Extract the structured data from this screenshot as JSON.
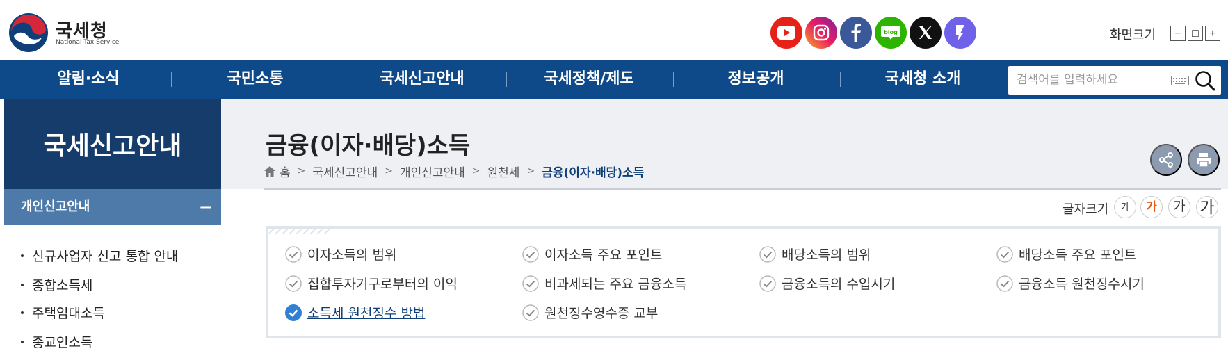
{
  "header": {
    "logo_kr": "국세청",
    "logo_en": "National Tax Service",
    "sns": [
      {
        "name": "youtube-icon",
        "color": "#e62117"
      },
      {
        "name": "instagram-icon",
        "color": "#d6249f"
      },
      {
        "name": "facebook-icon",
        "color": "#3b5998"
      },
      {
        "name": "blog-icon",
        "color": "#2db400",
        "label": "blog"
      },
      {
        "name": "x-icon",
        "color": "#111111"
      },
      {
        "name": "kakao-story-icon",
        "color": "#6f62e9"
      }
    ],
    "screen_size_label": "화면크기",
    "zoom_out": "−",
    "zoom_reset": "□",
    "zoom_in": "+"
  },
  "nav": {
    "items": [
      "알림·소식",
      "국민소통",
      "국세신고안내",
      "국세정책/제도",
      "정보공개",
      "국세청 소개"
    ],
    "search_placeholder": "검색어를 입력하세요"
  },
  "sidebar": {
    "title": "국세신고안내",
    "section": "개인신고안내",
    "section_toggle": "−",
    "items": [
      "신규사업자 신고 통합 안내",
      "종합소득세",
      "주택임대소득",
      "종교인소득"
    ]
  },
  "page": {
    "title": "금융(이자·배당)소득",
    "breadcrumb": [
      "홈",
      "국세신고안내",
      "개인신고안내",
      "원천세",
      "금융(이자·배당)소득"
    ],
    "font_size_label": "글자크기",
    "font_sizes": [
      "가",
      "가",
      "가",
      "가"
    ],
    "font_size_active_color": "#e8590c"
  },
  "tabs": {
    "items": [
      "이자소득의 범위",
      "이자소득 주요 포인트",
      "배당소득의 범위",
      "배당소득 주요 포인트",
      "집합투자기구로부터의 이익",
      "비과세되는 주요 금융소득",
      "금융소득의 수입시기",
      "금융소득 원천징수시기",
      "소득세 원천징수 방법",
      "원천징수영수증 교부"
    ],
    "active_index": 8
  },
  "colors": {
    "nav_bg": "#0e4a8a",
    "sidebar_head": "#163c6b",
    "sidebar_sub": "#4d7aa8",
    "active_check": "#2f7fd6"
  }
}
